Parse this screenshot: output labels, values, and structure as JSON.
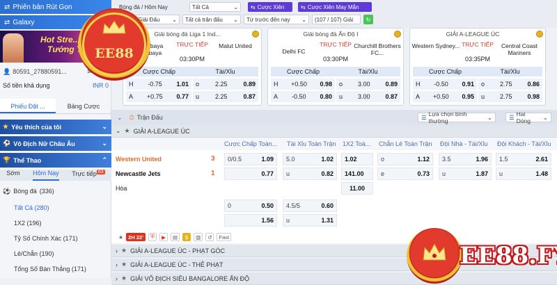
{
  "sidebar": {
    "version_btn": "Phiên bản Rút Gọn",
    "galaxy_btn": "Galaxy",
    "banner_line1": "Hot Stre...",
    "banner_line2": "Tướng Th...",
    "account_id": "80591_27880591...",
    "balance_label": "Số tiền khả dụng",
    "balance_value": "INR 0",
    "tab_bets": "Phiếu Đặt ...",
    "tab_table": "Bảng Cược",
    "section_favorites": "Yêu thích của tôi",
    "section_women": "Vô Địch Nữ Châu Âu",
    "section_sports": "Thể Thao",
    "subtabs": {
      "early": "Sớm",
      "today": "Hôm Nay",
      "live": "Trực tiếp",
      "live_count": "83"
    },
    "sport": {
      "name": "Bóng đá",
      "count": "(336)"
    },
    "markets": [
      {
        "label": "Tất Cả",
        "count": "(280)"
      },
      {
        "label": "1X2",
        "count": "(196)"
      },
      {
        "label": "Tỷ Số Chính Xác",
        "count": "(171)"
      },
      {
        "label": "Lẻ/Chẵn",
        "count": "(190)"
      },
      {
        "label": "Tổng Số Bàn Thắng",
        "count": "(171)"
      }
    ]
  },
  "topbar": {
    "breadcrumb": "Bóng đá / Hôm Nay",
    "sel_all": "Tất Cả",
    "btn_parlay": "Cược Xiên",
    "btn_lucky": "Cược Xiên May Mắn",
    "f_all_leagues": "Tất Cả Giải Đấu",
    "f_all_matches": "Tất cả trận đấu",
    "f_time": "Từ trước đến nay",
    "f_count": "(107 / 107) Giải"
  },
  "cards": [
    {
      "league": "Giải bóng đá Liga 1 Ind...",
      "home": "Persebaya Surabaya",
      "away": "Malut United",
      "live": "TRỰC TIẾP",
      "time": "03:30PM",
      "h_label": "Cược Chấp",
      "t_label": "Tài/Xỉu",
      "r1": {
        "hk": "H",
        "hv": "-0.75",
        "ho": "1.01",
        "tk": "o",
        "tv": "2.25",
        "to": "0.89"
      },
      "r2": {
        "hk": "A",
        "hv": "+0.75",
        "ho": "0.77",
        "tk": "u",
        "tv": "2.25",
        "to": "0.87"
      }
    },
    {
      "league": "Giải bóng đá Ấn Độ I",
      "home": "Delhi FC",
      "away": "Churchill Brothers FC...",
      "live": "TRỰC TIẾP",
      "time": "03:30PM",
      "h_label": "Cược Chấp",
      "t_label": "Tài/Xỉu",
      "r1": {
        "hk": "H",
        "hv": "+0.50",
        "ho": "0.98",
        "tk": "o",
        "tv": "3.00",
        "to": "0.89"
      },
      "r2": {
        "hk": "A",
        "hv": "-0.50",
        "ho": "0.80",
        "tk": "u",
        "tv": "3.00",
        "to": "0.87"
      }
    },
    {
      "league": "GIẢI A-LEAGUE ÚC",
      "home": "Western Sydney...",
      "away": "Central Coast Mariners",
      "live": "TRỰC TIẾP",
      "time": "03:35PM",
      "h_label": "Cược Chấp",
      "t_label": "Tài/Xỉu",
      "r1": {
        "hk": "H",
        "hv": "-0.50",
        "ho": "0.91",
        "tk": "o",
        "tv": "2.75",
        "to": "0.86"
      },
      "r2": {
        "hk": "A",
        "hv": "+0.50",
        "ho": "0.95",
        "tk": "u",
        "tv": "2.75",
        "to": "0.98"
      }
    }
  ],
  "main": {
    "title": "Trận Đấu",
    "sort": "Lựa chọn bình thường",
    "view": "Hai Dòng",
    "league": "GIẢI A-LEAGUE ÚC",
    "columns": [
      "Cược Chấp Toàn...",
      "Tài Xỉu Toàn Trận",
      "1X2 Toà...",
      "Chẵn Lẻ Toàn Trận",
      "Đội Nhà - Tài/Xỉu",
      "Đội Khách - Tài/Xỉu"
    ],
    "match": {
      "home": "Western United",
      "away": "Newcastle Jets",
      "draw": "Hòa",
      "home_score": "3",
      "away_score": "1",
      "hdp": {
        "line": "0/0.5",
        "home": "1.09",
        "away": "0.77"
      },
      "ou": {
        "line": "5.0",
        "over": "1.02",
        "uk": "u",
        "under": "0.82"
      },
      "x12": {
        "home": "1.02",
        "away": "141.00",
        "draw": "11.00"
      },
      "oe": {
        "ok": "o",
        "odd": "1.12",
        "ek": "e",
        "even": "0.73"
      },
      "home_ou": {
        "line": "3.5",
        "over": "1.96",
        "uk": "u",
        "under": "1.87"
      },
      "away_ou": {
        "line": "1.5",
        "over": "2.61",
        "uk": "u",
        "under": "1.48"
      },
      "alt_hdp": {
        "line": "0",
        "home": "0.50",
        "away": "1.56"
      },
      "alt_ou": {
        "line": "4.5/5",
        "over": "0.60",
        "uk": "u",
        "under": "1.31"
      }
    },
    "status": {
      "half": "2H",
      "minute": "22'",
      "fast": "Fast"
    },
    "more_leagues": [
      "GIẢI A-LEAGUE ÚC - PHẠT GÓC",
      "GIẢI A-LEAGUE ÚC - THẺ PHẠT",
      "GIẢI VÔ ĐỊCH SIÊU BANGALORE ẤN ĐỘ"
    ]
  },
  "branding": {
    "logo_text": "EE88",
    "site_text": "EE88.FYI"
  },
  "colors": {
    "accent": "#2c6ad6",
    "live": "#e23b2f",
    "brand_red": "#c4181b",
    "gold": "#f0c23a"
  }
}
